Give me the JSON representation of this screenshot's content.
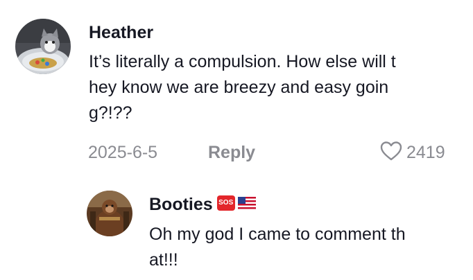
{
  "comment": {
    "username": "Heather",
    "lines": [
      "It’s literally a compulsion. How else will t",
      "hey know we are breezy and easy goin",
      "g?!??"
    ],
    "date": "2025-6-5",
    "reply_label": "Reply",
    "likes": "2419",
    "avatar_icon": "cat-avatar-icon",
    "like_icon": "heart-outline-icon"
  },
  "reply": {
    "username": "Booties",
    "badges": [
      "sos-emoji-icon",
      "us-flag-icon"
    ],
    "lines": [
      "Oh my god I came to comment th",
      "at!!!"
    ],
    "avatar_icon": "monkey-avatar-icon"
  },
  "colors": {
    "text": "#161823",
    "muted": "#8a8b91",
    "sos_red": "#e3262b"
  }
}
